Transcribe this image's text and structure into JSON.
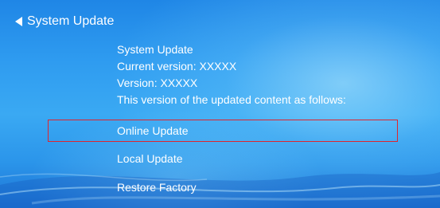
{
  "header": {
    "back_icon": "triangle-left-icon",
    "title": "System Update"
  },
  "info": {
    "heading": "System Update",
    "current_version": "Current version: XXXXX",
    "version": "Version: XXXXX",
    "description": "This version of the updated content as follows:"
  },
  "menu": {
    "items": [
      {
        "label": "Online Update",
        "selected": true
      },
      {
        "label": "Local Update",
        "selected": false
      },
      {
        "label": "Restore Factory",
        "selected": false
      }
    ]
  },
  "colors": {
    "background_top": "#1f86e6",
    "background_mid": "#3aa9f3",
    "selection_border": "#e0242d",
    "text": "#ffffff"
  }
}
